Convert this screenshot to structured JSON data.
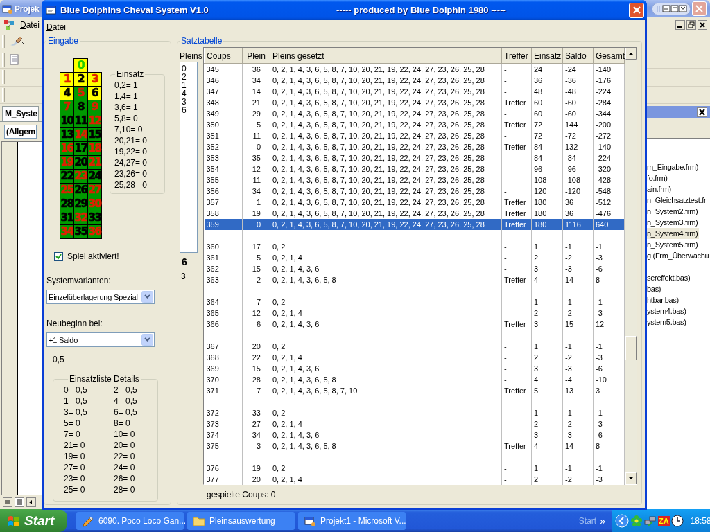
{
  "ide_window": {
    "title": "Projek",
    "menu": [
      "Datei"
    ],
    "code_tab": "M_Syste",
    "object_combo": "(Allgem",
    "explorer_groups": [
      {
        "items": [
          {
            "label": "m_Eingabe.frm)",
            "selected": false
          },
          {
            "label": "fo.frm)",
            "selected": false
          },
          {
            "label": "ain.frm)",
            "selected": false
          },
          {
            "label": "n_Gleichsatztest.fr",
            "selected": false
          },
          {
            "label": "n_System2.frm)",
            "selected": false
          },
          {
            "label": "n_System3.frm)",
            "selected": false
          },
          {
            "label": "n_System4.frm)",
            "selected": true
          },
          {
            "label": "n_System5.frm)",
            "selected": false
          },
          {
            "label": "g (Frm_Überwachu",
            "selected": false
          }
        ]
      },
      {
        "items": [
          {
            "label": "sereffekt.bas)",
            "selected": false
          },
          {
            "label": "bas)",
            "selected": false
          },
          {
            "label": "htbar.bas)",
            "selected": false
          },
          {
            "label": "ystem4.bas)",
            "selected": false
          },
          {
            "label": "ystem5.bas)",
            "selected": false
          }
        ]
      }
    ]
  },
  "window": {
    "title": "Blue Dolphins Cheval System V1.0",
    "subtitle": "----- produced by Blue Dolphin 1980 -----",
    "menu": [
      "Datei"
    ]
  },
  "eingabe": {
    "title": "Eingabe",
    "grid": [
      {
        "number": "0",
        "color": "#22cc00",
        "selected": true
      },
      {
        "number": "1",
        "color": "#e02000",
        "selected": true
      },
      {
        "number": "2",
        "color": "#000000",
        "selected": true
      },
      {
        "number": "3",
        "color": "#e02000",
        "selected": true
      },
      {
        "number": "4",
        "color": "#000000",
        "selected": true
      },
      {
        "number": "5",
        "color": "#e02000",
        "selected": false
      },
      {
        "number": "6",
        "color": "#000000",
        "selected": true
      },
      {
        "number": "7",
        "color": "#e02000",
        "selected": false
      },
      {
        "number": "8",
        "color": "#000000",
        "selected": false
      },
      {
        "number": "9",
        "color": "#e02000",
        "selected": false
      },
      {
        "number": "10",
        "color": "#000000",
        "selected": false
      },
      {
        "number": "11",
        "color": "#000000",
        "selected": false
      },
      {
        "number": "12",
        "color": "#e02000",
        "selected": false
      },
      {
        "number": "13",
        "color": "#000000",
        "selected": false
      },
      {
        "number": "14",
        "color": "#e02000",
        "selected": false
      },
      {
        "number": "15",
        "color": "#000000",
        "selected": false
      },
      {
        "number": "16",
        "color": "#e02000",
        "selected": false
      },
      {
        "number": "17",
        "color": "#000000",
        "selected": false
      },
      {
        "number": "18",
        "color": "#e02000",
        "selected": false
      },
      {
        "number": "19",
        "color": "#e02000",
        "selected": false
      },
      {
        "number": "20",
        "color": "#000000",
        "selected": false
      },
      {
        "number": "21",
        "color": "#e02000",
        "selected": false
      },
      {
        "number": "22",
        "color": "#000000",
        "selected": false
      },
      {
        "number": "23",
        "color": "#e02000",
        "selected": false
      },
      {
        "number": "24",
        "color": "#000000",
        "selected": false
      },
      {
        "number": "25",
        "color": "#e02000",
        "selected": false
      },
      {
        "number": "26",
        "color": "#000000",
        "selected": false
      },
      {
        "number": "27",
        "color": "#e02000",
        "selected": false
      },
      {
        "number": "28",
        "color": "#000000",
        "selected": false
      },
      {
        "number": "29",
        "color": "#000000",
        "selected": false
      },
      {
        "number": "30",
        "color": "#e02000",
        "selected": false
      },
      {
        "number": "31",
        "color": "#000000",
        "selected": false
      },
      {
        "number": "32",
        "color": "#e02000",
        "selected": false
      },
      {
        "number": "33",
        "color": "#000000",
        "selected": false
      },
      {
        "number": "34",
        "color": "#e02000",
        "selected": false
      },
      {
        "number": "35",
        "color": "#000000",
        "selected": false
      },
      {
        "number": "36",
        "color": "#e02000",
        "selected": false
      }
    ],
    "einsatz": {
      "title": "Einsatz",
      "entries": [
        "0,2= 1",
        "1,4= 1",
        "3,6= 1",
        "5,8= 0",
        "7,10= 0",
        "20,21= 0",
        "19,22= 0",
        "24,27= 0",
        "23,26= 0",
        "25,28= 0"
      ]
    },
    "spiel_aktiviert": {
      "label": "Spiel aktiviert!",
      "checked": true
    },
    "systemvarianten": {
      "label": "Systemvarianten:",
      "value": "Einzelüberlagerung Spezial"
    },
    "neubeginn": {
      "label": "Neubeginn bei:",
      "value": "+1 Saldo"
    },
    "unit": "0,5",
    "details": {
      "title": "Einsatzliste Details",
      "entries": [
        [
          "0= 0,5",
          "2= 0,5"
        ],
        [
          "1= 0,5",
          "4= 0,5"
        ],
        [
          "3= 0,5",
          "6= 0,5"
        ],
        [
          "5= 0",
          "8= 0"
        ],
        [
          "7= 0",
          "10= 0"
        ],
        [
          "21= 0",
          "20= 0"
        ],
        [
          "19= 0",
          "22= 0"
        ],
        [
          "27= 0",
          "24= 0"
        ],
        [
          "23= 0",
          "26= 0"
        ],
        [
          "25= 0",
          "28= 0"
        ]
      ]
    }
  },
  "satztabelle": {
    "title": "Satztabelle",
    "pleins_label": "Pleins",
    "pleins": [
      "0",
      "2",
      "1",
      "4",
      "3",
      "6"
    ],
    "count": "6",
    "value": "3",
    "columns": [
      "Coups",
      "Plein",
      "Pleins gesetzt",
      "Treffer",
      "Einsatz",
      "Saldo",
      "Gesamt"
    ],
    "groups": [
      {
        "rows": [
          {
            "cells": [
              "345",
              "36",
              "0, 2, 1, 4, 3, 6, 5, 8, 7, 10, 20, 21, 19, 22, 24, 27, 23, 26, 25, 28",
              "-",
              "24",
              "-24",
              "-140"
            ],
            "selected": false
          },
          {
            "cells": [
              "346",
              "34",
              "0, 2, 1, 4, 3, 6, 5, 8, 7, 10, 20, 21, 19, 22, 24, 27, 23, 26, 25, 28",
              "-",
              "36",
              "-36",
              "-176"
            ],
            "selected": false
          },
          {
            "cells": [
              "347",
              "14",
              "0, 2, 1, 4, 3, 6, 5, 8, 7, 10, 20, 21, 19, 22, 24, 27, 23, 26, 25, 28",
              "-",
              "48",
              "-48",
              "-224"
            ],
            "selected": false
          },
          {
            "cells": [
              "348",
              "21",
              "0, 2, 1, 4, 3, 6, 5, 8, 7, 10, 20, 21, 19, 22, 24, 27, 23, 26, 25, 28",
              "Treffer",
              "60",
              "-60",
              "-284"
            ],
            "selected": false
          },
          {
            "cells": [
              "349",
              "29",
              "0, 2, 1, 4, 3, 6, 5, 8, 7, 10, 20, 21, 19, 22, 24, 27, 23, 26, 25, 28",
              "-",
              "60",
              "-60",
              "-344"
            ],
            "selected": false
          },
          {
            "cells": [
              "350",
              "5",
              "0, 2, 1, 4, 3, 6, 5, 8, 7, 10, 20, 21, 19, 22, 24, 27, 23, 26, 25, 28",
              "Treffer",
              "72",
              "144",
              "-200"
            ],
            "selected": false
          },
          {
            "cells": [
              "351",
              "11",
              "0, 2, 1, 4, 3, 6, 5, 8, 7, 10, 20, 21, 19, 22, 24, 27, 23, 26, 25, 28",
              "-",
              "72",
              "-72",
              "-272"
            ],
            "selected": false
          },
          {
            "cells": [
              "352",
              "0",
              "0, 2, 1, 4, 3, 6, 5, 8, 7, 10, 20, 21, 19, 22, 24, 27, 23, 26, 25, 28",
              "Treffer",
              "84",
              "132",
              "-140"
            ],
            "selected": false
          },
          {
            "cells": [
              "353",
              "35",
              "0, 2, 1, 4, 3, 6, 5, 8, 7, 10, 20, 21, 19, 22, 24, 27, 23, 26, 25, 28",
              "-",
              "84",
              "-84",
              "-224"
            ],
            "selected": false
          },
          {
            "cells": [
              "354",
              "12",
              "0, 2, 1, 4, 3, 6, 5, 8, 7, 10, 20, 21, 19, 22, 24, 27, 23, 26, 25, 28",
              "-",
              "96",
              "-96",
              "-320"
            ],
            "selected": false
          },
          {
            "cells": [
              "355",
              "11",
              "0, 2, 1, 4, 3, 6, 5, 8, 7, 10, 20, 21, 19, 22, 24, 27, 23, 26, 25, 28",
              "-",
              "108",
              "-108",
              "-428"
            ],
            "selected": false
          },
          {
            "cells": [
              "356",
              "34",
              "0, 2, 1, 4, 3, 6, 5, 8, 7, 10, 20, 21, 19, 22, 24, 27, 23, 26, 25, 28",
              "-",
              "120",
              "-120",
              "-548"
            ],
            "selected": false
          },
          {
            "cells": [
              "357",
              "1",
              "0, 2, 1, 4, 3, 6, 5, 8, 7, 10, 20, 21, 19, 22, 24, 27, 23, 26, 25, 28",
              "Treffer",
              "180",
              "36",
              "-512"
            ],
            "selected": false
          },
          {
            "cells": [
              "358",
              "19",
              "0, 2, 1, 4, 3, 6, 5, 8, 7, 10, 20, 21, 19, 22, 24, 27, 23, 26, 25, 28",
              "Treffer",
              "180",
              "36",
              "-476"
            ],
            "selected": false
          },
          {
            "cells": [
              "359",
              "0",
              "0, 2, 1, 4, 3, 6, 5, 8, 7, 10, 20, 21, 19, 22, 24, 27, 23, 26, 25, 28",
              "Treffer",
              "180",
              "1116",
              "640"
            ],
            "selected": true
          }
        ]
      },
      {
        "rows": [
          {
            "cells": [
              "360",
              "17",
              "0, 2",
              "-",
              "1",
              "-1",
              "-1"
            ],
            "selected": false
          },
          {
            "cells": [
              "361",
              "5",
              "0, 2, 1, 4",
              "-",
              "2",
              "-2",
              "-3"
            ],
            "selected": false
          },
          {
            "cells": [
              "362",
              "15",
              "0, 2, 1, 4, 3, 6",
              "-",
              "3",
              "-3",
              "-6"
            ],
            "selected": false
          },
          {
            "cells": [
              "363",
              "2",
              "0, 2, 1, 4, 3, 6, 5, 8",
              "Treffer",
              "4",
              "14",
              "8"
            ],
            "selected": false
          }
        ]
      },
      {
        "rows": [
          {
            "cells": [
              "364",
              "7",
              "0, 2",
              "-",
              "1",
              "-1",
              "-1"
            ],
            "selected": false
          },
          {
            "cells": [
              "365",
              "12",
              "0, 2, 1, 4",
              "-",
              "2",
              "-2",
              "-3"
            ],
            "selected": false
          },
          {
            "cells": [
              "366",
              "6",
              "0, 2, 1, 4, 3, 6",
              "Treffer",
              "3",
              "15",
              "12"
            ],
            "selected": false
          }
        ]
      },
      {
        "rows": [
          {
            "cells": [
              "367",
              "20",
              "0, 2",
              "-",
              "1",
              "-1",
              "-1"
            ],
            "selected": false
          },
          {
            "cells": [
              "368",
              "22",
              "0, 2, 1, 4",
              "-",
              "2",
              "-2",
              "-3"
            ],
            "selected": false
          },
          {
            "cells": [
              "369",
              "15",
              "0, 2, 1, 4, 3, 6",
              "-",
              "3",
              "-3",
              "-6"
            ],
            "selected": false
          },
          {
            "cells": [
              "370",
              "28",
              "0, 2, 1, 4, 3, 6, 5, 8",
              "-",
              "4",
              "-4",
              "-10"
            ],
            "selected": false
          },
          {
            "cells": [
              "371",
              "7",
              "0, 2, 1, 4, 3, 6, 5, 8, 7, 10",
              "Treffer",
              "5",
              "13",
              "3"
            ],
            "selected": false
          }
        ]
      },
      {
        "rows": [
          {
            "cells": [
              "372",
              "33",
              "0, 2",
              "-",
              "1",
              "-1",
              "-1"
            ],
            "selected": false
          },
          {
            "cells": [
              "373",
              "27",
              "0, 2, 1, 4",
              "-",
              "2",
              "-2",
              "-3"
            ],
            "selected": false
          },
          {
            "cells": [
              "374",
              "34",
              "0, 2, 1, 4, 3, 6",
              "-",
              "3",
              "-3",
              "-6"
            ],
            "selected": false
          },
          {
            "cells": [
              "375",
              "3",
              "0, 2, 1, 4, 3, 6, 5, 8",
              "Treffer",
              "4",
              "14",
              "8"
            ],
            "selected": false
          }
        ]
      },
      {
        "rows": [
          {
            "cells": [
              "376",
              "19",
              "0, 2",
              "-",
              "1",
              "-1",
              "-1"
            ],
            "selected": false
          },
          {
            "cells": [
              "377",
              "20",
              "0, 2, 1, 4",
              "-",
              "2",
              "-2",
              "-3"
            ],
            "selected": false
          }
        ]
      }
    ],
    "footer": "gespielte Coups: 0"
  },
  "taskbar": {
    "start": "Start",
    "tasks": [
      {
        "label": "6090. Poco Loco Gan...",
        "selected": false
      },
      {
        "label": "Pleinsauswertung",
        "selected": false
      },
      {
        "label": "Projekt1 - Microsoft V...",
        "selected": false
      }
    ],
    "tray_label": "Start",
    "tray_chevron": "»",
    "tray_badge": "ZA",
    "clock": "18:58"
  }
}
